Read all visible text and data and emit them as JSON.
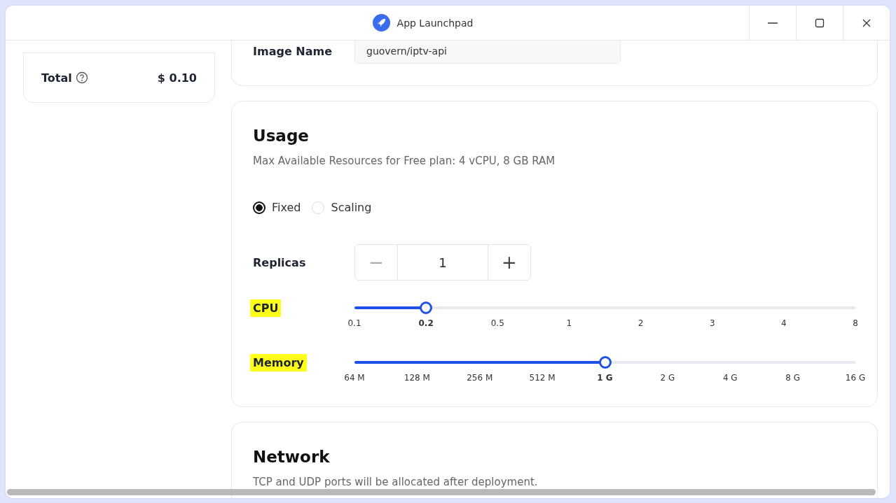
{
  "window": {
    "title": "App Launchpad"
  },
  "summary": {
    "total_label": "Total",
    "total_value": "$ 0.10"
  },
  "image": {
    "label": "Image Name",
    "value": "guovern/iptv-api"
  },
  "usage": {
    "title": "Usage",
    "description": "Max Available Resources for Free plan: 4 vCPU, 8 GB RAM",
    "modes": [
      {
        "label": "Fixed",
        "selected": true
      },
      {
        "label": "Scaling",
        "selected": false
      }
    ],
    "replicas": {
      "label": "Replicas",
      "decrement": "−",
      "value": "1",
      "increment": "+"
    },
    "sliders": [
      {
        "label": "CPU",
        "highlighted": true,
        "level": 0.143,
        "ticks": [
          {
            "label": "0.1",
            "selected": false
          },
          {
            "label": "0.2",
            "selected": true
          },
          {
            "label": "0.5",
            "selected": false
          },
          {
            "label": "1",
            "selected": false
          },
          {
            "label": "2",
            "selected": false
          },
          {
            "label": "3",
            "selected": false
          },
          {
            "label": "4",
            "selected": false
          },
          {
            "label": "8",
            "selected": false
          }
        ]
      },
      {
        "label": "Memory",
        "highlighted": true,
        "level": 0.5,
        "ticks": [
          {
            "label": "64 M",
            "selected": false
          },
          {
            "label": "128 M",
            "selected": false
          },
          {
            "label": "256 M",
            "selected": false
          },
          {
            "label": "512 M",
            "selected": false
          },
          {
            "label": "1 G",
            "selected": true
          },
          {
            "label": "2 G",
            "selected": false
          },
          {
            "label": "4 G",
            "selected": false
          },
          {
            "label": "8 G",
            "selected": false
          },
          {
            "label": "16 G",
            "selected": false
          }
        ]
      }
    ]
  },
  "network": {
    "title": "Network",
    "description": "TCP and UDP ports will be allocated after deployment."
  }
}
